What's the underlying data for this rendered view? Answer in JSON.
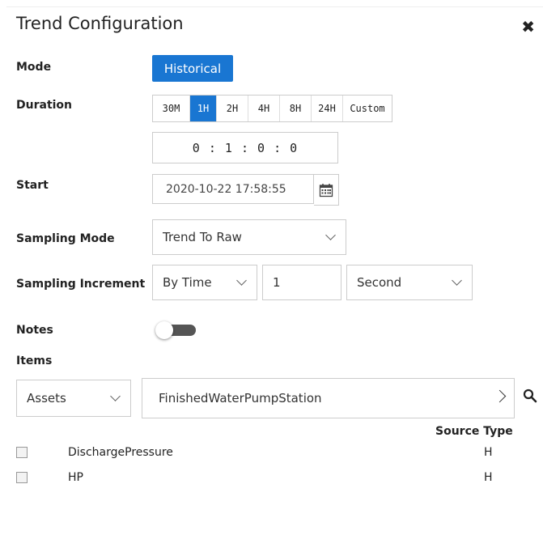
{
  "header": {
    "title": "Trend Configuration",
    "close_icon": "close-icon"
  },
  "mode": {
    "label": "Mode",
    "value": "Historical"
  },
  "duration": {
    "label": "Duration",
    "options": [
      "30M",
      "1H",
      "2H",
      "4H",
      "8H",
      "24H",
      "Custom"
    ],
    "selected": "1H",
    "time_value": "0 : 1 : 0 : 0"
  },
  "start": {
    "label": "Start",
    "value": "2020-10-22 17:58:55",
    "icon": "calendar-icon"
  },
  "sampling_mode": {
    "label": "Sampling Mode",
    "value": "Trend To Raw"
  },
  "sampling_increment": {
    "label": "Sampling Increment",
    "type": "By Time",
    "amount": "1",
    "unit": "Second"
  },
  "notes": {
    "label": "Notes",
    "enabled": false
  },
  "items": {
    "label": "Items",
    "category": "Assets",
    "path": "FinishedWaterPumpStation",
    "source_type_header": "Source Type",
    "rows": [
      {
        "name": "DischargePressure",
        "source_type": "H",
        "checked": false
      },
      {
        "name": "HP",
        "source_type": "H",
        "checked": false
      }
    ]
  },
  "colors": {
    "accent": "#1976d2"
  }
}
